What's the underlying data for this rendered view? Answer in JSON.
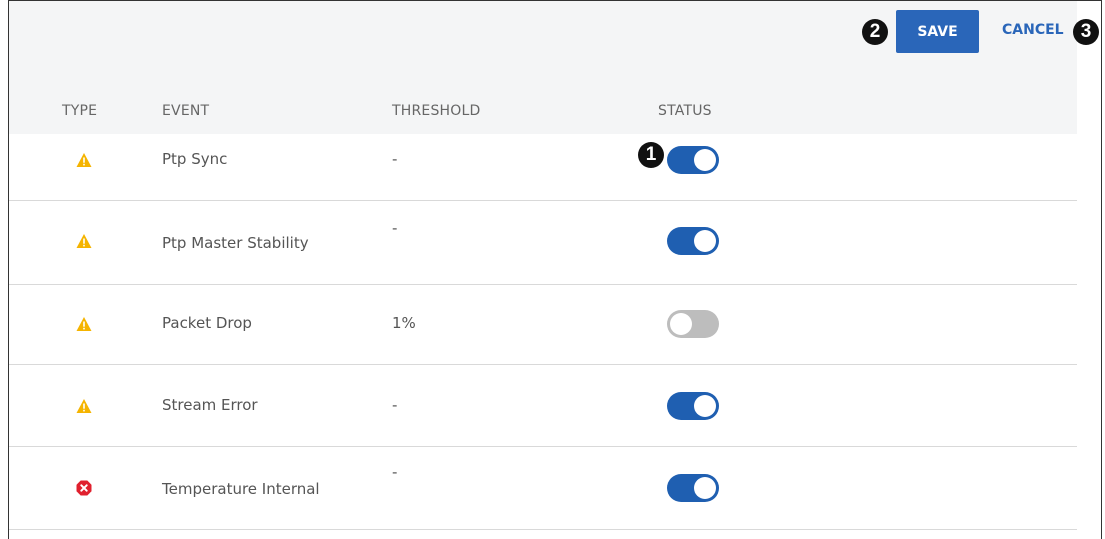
{
  "toolbar": {
    "save_label": "SAVE",
    "cancel_label": "CANCEL"
  },
  "callouts": {
    "one": "1",
    "two": "2",
    "three": "3"
  },
  "table": {
    "headers": {
      "type": "TYPE",
      "event": "EVENT",
      "threshold": "THRESHOLD",
      "status": "STATUS"
    },
    "rows": [
      {
        "type": "warning",
        "event": "Ptp Sync",
        "threshold": "-",
        "status": "on"
      },
      {
        "type": "warning",
        "event": "Ptp Master Stability",
        "threshold": "-",
        "status": "on"
      },
      {
        "type": "warning",
        "event": "Packet Drop",
        "threshold": "1%",
        "status": "off"
      },
      {
        "type": "warning",
        "event": "Stream Error",
        "threshold": "-",
        "status": "on"
      },
      {
        "type": "error",
        "event": "Temperature Internal",
        "threshold": "-",
        "status": "on"
      }
    ]
  },
  "colors": {
    "accent": "#2a66b9",
    "toggle_on": "#1f5fb1",
    "toggle_off": "#bdbdbd",
    "warning": "#f5b400",
    "error": "#e0202e"
  }
}
